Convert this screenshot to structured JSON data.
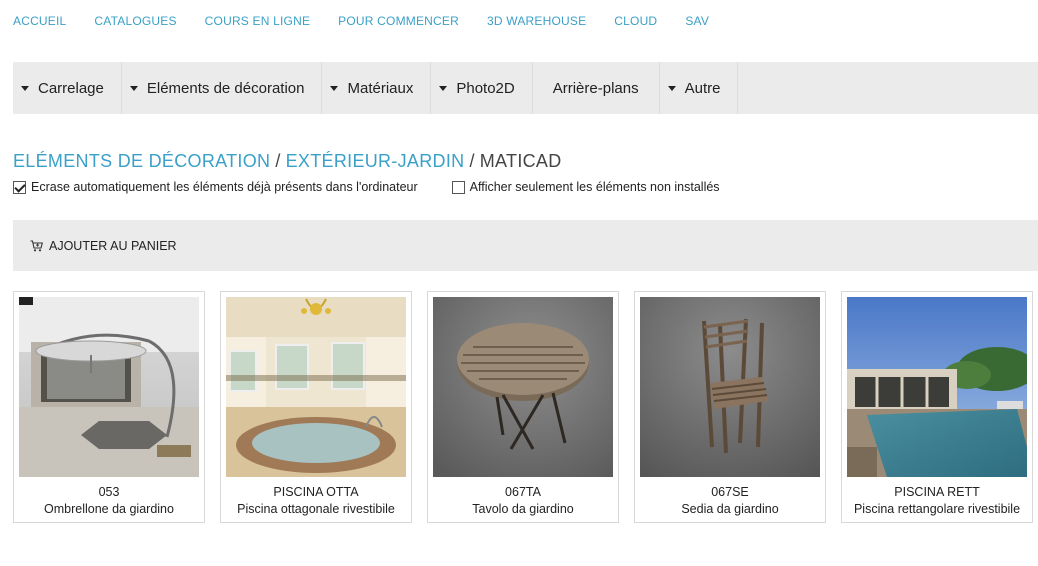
{
  "topnav": [
    "ACCUEIL",
    "CATALOGUES",
    "COURS EN LIGNE",
    "POUR COMMENCER",
    "3D WAREHOUSE",
    "CLOUD",
    "SAV"
  ],
  "categories": [
    {
      "label": "Carrelage",
      "caret": true
    },
    {
      "label": "Eléments de décoration",
      "caret": true
    },
    {
      "label": "Matériaux",
      "caret": true
    },
    {
      "label": "Photo2D",
      "caret": true
    },
    {
      "label": "Arrière-plans",
      "caret": false
    },
    {
      "label": "Autre",
      "caret": true
    }
  ],
  "breadcrumb": {
    "level1": "ELÉMENTS DE DÉCORATION",
    "level2": "EXTÉRIEUR-JARDIN",
    "current": "MATICAD",
    "separator": "/"
  },
  "options": {
    "overwrite_label": "Ecrase automatiquement les éléments déjà présents dans l'ordinateur",
    "overwrite_checked": true,
    "not_installed_label": "Afficher seulement les éléments non installés",
    "not_installed_checked": false
  },
  "cart": {
    "add_label": "AJOUTER AU PANIER"
  },
  "products": [
    {
      "code": "053",
      "name": "Ombrellone da giardino"
    },
    {
      "code": "PISCINA OTTA",
      "name": "Piscina ottagonale rivestibile"
    },
    {
      "code": "067TA",
      "name": "Tavolo da giardino"
    },
    {
      "code": "067SE",
      "name": "Sedia da giardino"
    },
    {
      "code": "PISCINA RETT",
      "name": "Piscina rettangolare rivestibile"
    }
  ],
  "colors": {
    "link": "#3aa0c8",
    "bar": "#ebebeb"
  }
}
